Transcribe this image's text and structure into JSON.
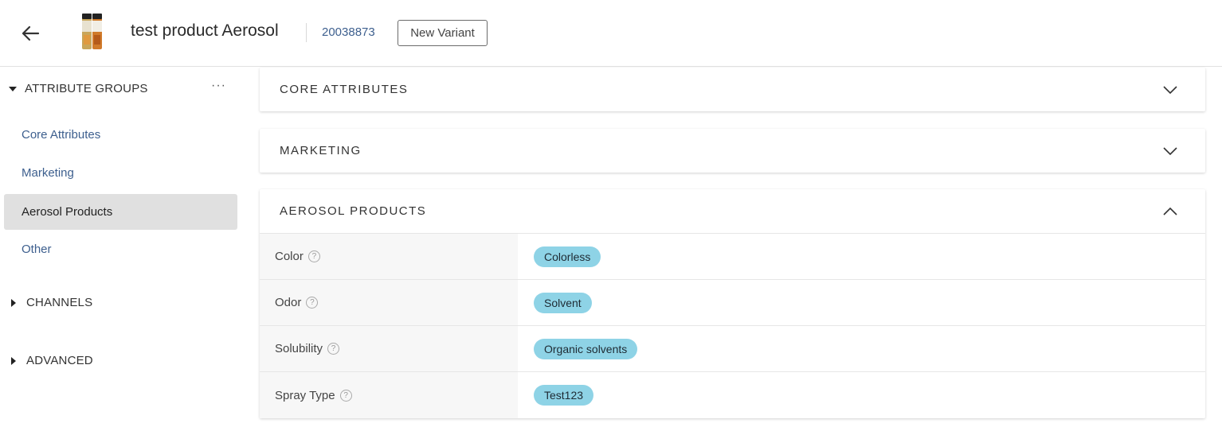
{
  "header": {
    "title": "test product Aerosol",
    "product_id": "20038873",
    "new_variant_label": "New Variant"
  },
  "sidebar": {
    "attribute_groups_label": "ATTRIBUTE GROUPS",
    "more_label": "···",
    "items": [
      {
        "label": "Core Attributes",
        "active": false
      },
      {
        "label": "Marketing",
        "active": false
      },
      {
        "label": "Aerosol Products",
        "active": true
      },
      {
        "label": "Other",
        "active": false
      }
    ],
    "channels_label": "CHANNELS",
    "advanced_label": "ADVANCED"
  },
  "panels": [
    {
      "title": "CORE ATTRIBUTES",
      "expanded": false
    },
    {
      "title": "MARKETING",
      "expanded": false
    },
    {
      "title": "AEROSOL PRODUCTS",
      "expanded": true,
      "rows": [
        {
          "label": "Color",
          "value": "Colorless"
        },
        {
          "label": "Odor",
          "value": "Solvent"
        },
        {
          "label": "Solubility",
          "value": "Organic solvents"
        },
        {
          "label": "Spray Type",
          "value": "Test123"
        }
      ]
    }
  ],
  "help_icon_text": "?",
  "colors": {
    "link": "#3d5f8e",
    "chip": "#8ed3e6",
    "active_item": "#e0e0e0"
  },
  "icons": {
    "back": "arrow-left-icon",
    "expand": "chevron-down-icon",
    "collapse": "chevron-up-icon",
    "help": "question-circle-icon"
  }
}
